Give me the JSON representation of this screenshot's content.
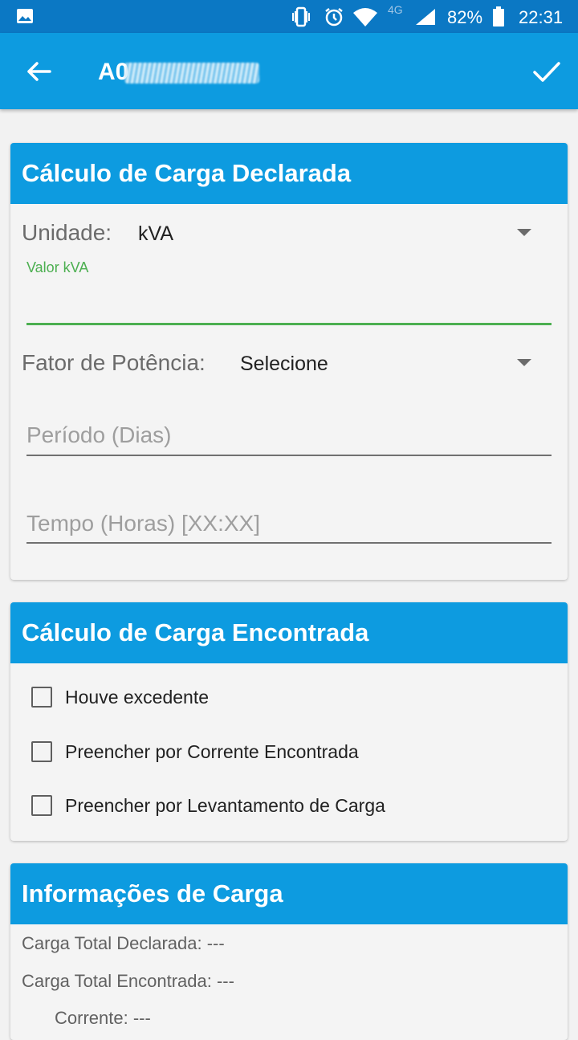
{
  "status_bar": {
    "battery": "82%",
    "time": "22:31",
    "network": "4G"
  },
  "app_bar": {
    "title": "A0"
  },
  "declared": {
    "header": "Cálculo de Carga Declarada",
    "unit_label": "Unidade:",
    "unit_value": "kVA",
    "kva_label": "Valor kVA",
    "kva_value": "",
    "power_factor_label": "Fator de Potência:",
    "power_factor_value": "Selecione",
    "period_placeholder": "Período (Dias)",
    "time_placeholder": "Tempo (Horas) [XX:XX]"
  },
  "found": {
    "header": "Cálculo de Carga Encontrada",
    "options": [
      {
        "label": "Houve excedente",
        "checked": false
      },
      {
        "label": "Preencher por Corrente Encontrada",
        "checked": false
      },
      {
        "label": "Preencher por Levantamento de Carga",
        "checked": false
      }
    ]
  },
  "info": {
    "header": "Informações de Carga",
    "total_declared": "Carga Total Declarada: ---",
    "total_found": "Carga Total Encontrada: ---",
    "current": "Corrente: ---"
  },
  "colors": {
    "status_bar": "#0b78c4",
    "app_bar": "#0d9be0",
    "accent_green": "#4caf50"
  }
}
